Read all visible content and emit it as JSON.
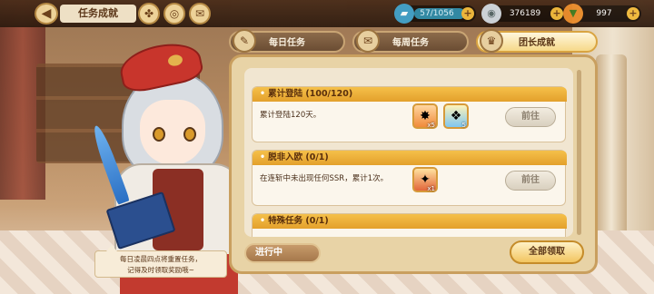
{
  "header": {
    "title": "任务成就",
    "back_glyph": "◀"
  },
  "resources": {
    "stamina": {
      "value": "57/1056",
      "color": "#2d8aa8"
    },
    "gems": {
      "value": "376189"
    },
    "carrots": {
      "value": "997"
    }
  },
  "tabs": [
    {
      "label": "每日任务",
      "icon": "quill-book-icon",
      "active": false
    },
    {
      "label": "每周任务",
      "icon": "scroll-icon",
      "active": false
    },
    {
      "label": "团长成就",
      "icon": "trophy-icon",
      "active": true
    }
  ],
  "tasks": [
    {
      "title": "累计登陆 (100/120)",
      "description": "累计登陆120天。",
      "button": "前往",
      "rewards": [
        {
          "icon": "fire-gem-icon",
          "count": "x5"
        },
        {
          "icon": "crystal-icon",
          "count": "5"
        }
      ]
    },
    {
      "title": "脱非入欧 (0/1)",
      "description": "在连斩中未出现任何SSR，累计1次。",
      "button": "前往",
      "rewards": [
        {
          "icon": "ticket-icon",
          "count": "x1"
        }
      ]
    },
    {
      "title": "特殊任务 (0/1)",
      "description": "",
      "button": "",
      "rewards": []
    }
  ],
  "footer": {
    "status": "进行中",
    "claim_all": "全部领取"
  },
  "tip": {
    "line1": "每日凌晨四点将重置任务，",
    "line2": "记得及时领取奖励哦~"
  }
}
